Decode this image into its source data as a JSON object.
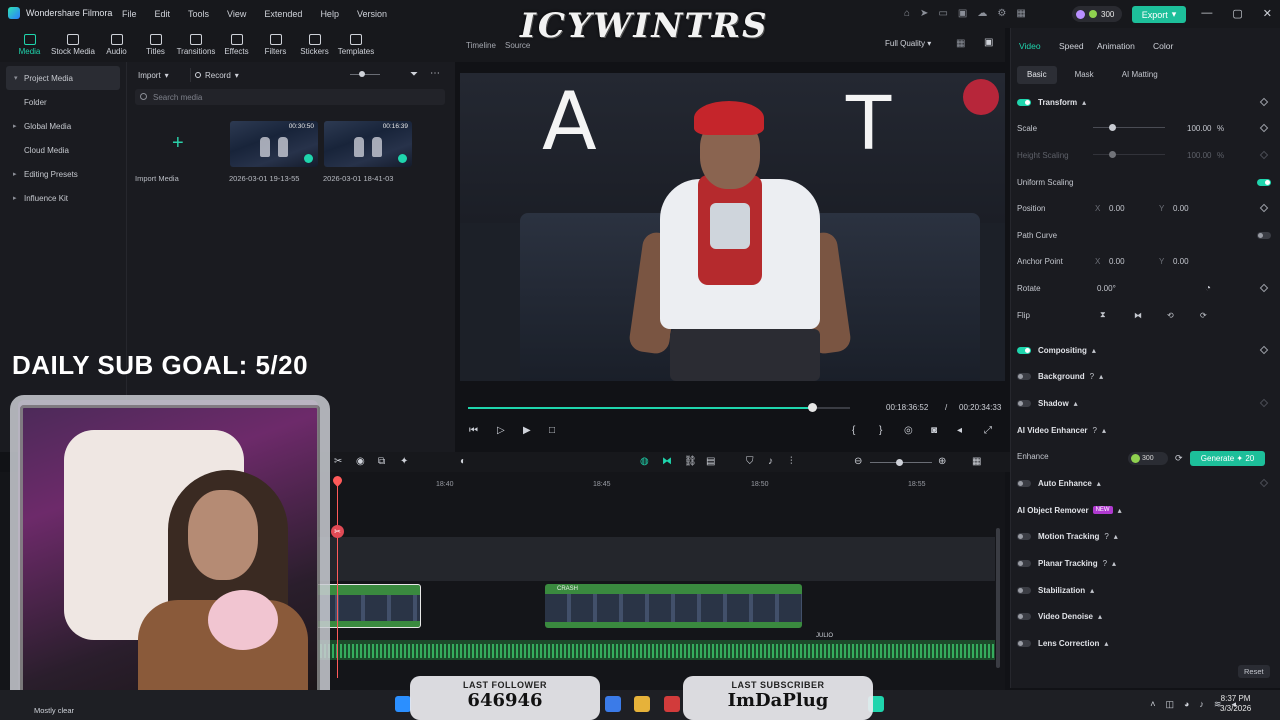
{
  "app": {
    "title": "Wondershare Filmora"
  },
  "menu": [
    "File",
    "Edit",
    "Tools",
    "View",
    "Extended",
    "Help",
    "Version"
  ],
  "header": {
    "credits": "300",
    "export_label": "Export"
  },
  "overlay": {
    "channel_title": "ICYWINTRS",
    "goal_text": "DAILY SUB GOAL: 5/20"
  },
  "media_tabs": [
    "Media",
    "Stock Media",
    "Audio",
    "Titles",
    "Transitions",
    "Effects",
    "Filters",
    "Stickers",
    "Templates"
  ],
  "media_panel": {
    "import_label": "Import",
    "record_label": "Record",
    "search_placeholder": "Search media",
    "nav": [
      {
        "label": "Project Media",
        "caret": "▾",
        "selected": true
      },
      {
        "label": "Folder",
        "caret": ""
      },
      {
        "label": "Global Media",
        "caret": "▸"
      },
      {
        "label": "Cloud Media",
        "caret": ""
      },
      {
        "label": "Editing Presets",
        "caret": "▸"
      },
      {
        "label": "Influence Kit",
        "caret": "▸"
      }
    ],
    "import_tile_label": "Import Media",
    "clips": [
      {
        "name": "2026-03-01 19-13-55",
        "duration": "00:30:50"
      },
      {
        "name": "2026-03-01 18-41-03",
        "duration": "00:16:39"
      }
    ]
  },
  "preview": {
    "tabs": [
      "Timeline",
      "Source"
    ],
    "quality": "Full Quality",
    "current_time": "00:18:36:52",
    "separator": "/",
    "total_time": "00:20:34:33",
    "progress_fraction": 0.9,
    "frame_letters": [
      "A",
      "T"
    ]
  },
  "inspector": {
    "tabs": [
      "Video",
      "Speed",
      "Animation",
      "Color"
    ],
    "subtabs": [
      "Basic",
      "Mask",
      "AI Matting"
    ],
    "transform_label": "Transform",
    "scale_label": "Scale",
    "scale_value": "100.00",
    "scale_unit": "%",
    "height_scaling_label": "Height Scaling",
    "height_scaling_value": "100.00",
    "uniform_scaling_label": "Uniform Scaling",
    "position_label": "Position",
    "position_x": "0.00",
    "position_y": "0.00",
    "axis_x": "X",
    "axis_y": "Y",
    "path_curve_label": "Path Curve",
    "anchor_point_label": "Anchor Point",
    "anchor_x": "0.00",
    "anchor_y": "0.00",
    "rotate_label": "Rotate",
    "rotate_value": "0.00°",
    "flip_label": "Flip",
    "compositing_label": "Compositing",
    "background_label": "Background",
    "shadow_label": "Shadow",
    "ai_video_enhancer_label": "AI Video Enhancer",
    "enhance_label": "Enhance",
    "enhance_cost": "300",
    "generate_label": "Generate",
    "generate_credits": "20",
    "auto_enhance_label": "Auto Enhance",
    "ai_object_remover_label": "AI Object Remover",
    "new_badge": "NEW",
    "motion_tracking_label": "Motion Tracking",
    "planar_tracking_label": "Planar Tracking",
    "stabilization_label": "Stabilization",
    "video_denoise_label": "Video Denoise",
    "lens_correction_label": "Lens Correction",
    "reset_label": "Reset"
  },
  "timeline": {
    "ruler": [
      "18:40",
      "18:45",
      "18:50",
      "18:55"
    ],
    "clip_name": "CRASH",
    "audio_name": "JULIO"
  },
  "stream_widgets": {
    "last_follower_label": "LAST FOLLOWER",
    "last_follower_value": "646946",
    "last_subscriber_label": "LAST SUBSCRIBER",
    "last_subscriber_value": "ImDaPlug"
  },
  "taskbar": {
    "weather": "Mostly clear",
    "time": "8:37 PM",
    "date": "3/3/2026"
  },
  "colors": {
    "accent": "#1fd5ad",
    "playhead": "#ff5a5a",
    "clip": "#3a8a3f"
  }
}
